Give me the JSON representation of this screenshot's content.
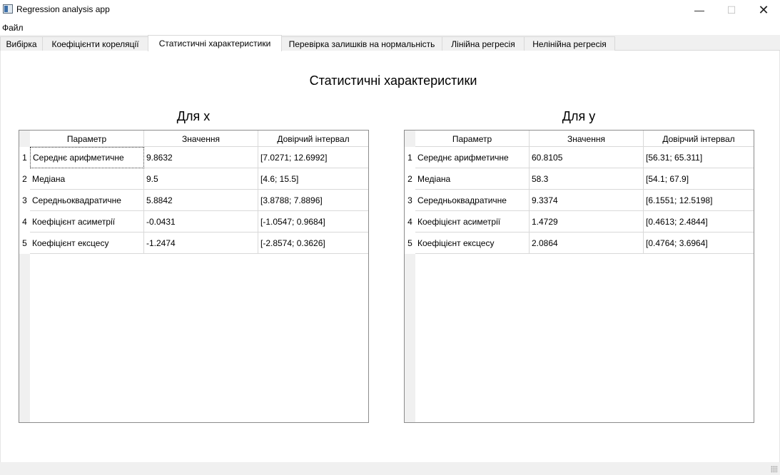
{
  "window": {
    "title": "Regression analysis app",
    "minimize_icon": "—",
    "maximize_icon": "☐",
    "close_icon": "✕"
  },
  "menu": {
    "file_label": "Файл"
  },
  "tabs": [
    {
      "label": "Вибірка"
    },
    {
      "label": "Коефіцієнти кореляції"
    },
    {
      "label": "Статистичні характеристики"
    },
    {
      "label": "Перевірка залишків на нормальність"
    },
    {
      "label": "Лінійна регресія"
    },
    {
      "label": "Нелінійна регресія"
    }
  ],
  "active_tab": 2,
  "page_title": "Статистичні характеристики",
  "columns": [
    "Параметр",
    "Значення",
    "Довірчий інтервал"
  ],
  "table_x": {
    "title": "Для x",
    "rows": [
      {
        "n": "1",
        "param": "Середнє арифметичне",
        "value": "9.8632",
        "ci": "[7.0271; 12.6992]"
      },
      {
        "n": "2",
        "param": "Медіана",
        "value": "9.5",
        "ci": "[4.6; 15.5]"
      },
      {
        "n": "3",
        "param": "Середньоквадратичне",
        "value": "5.8842",
        "ci": "[3.8788; 7.8896]"
      },
      {
        "n": "4",
        "param": "Коефіцієнт асиметрії",
        "value": "-0.0431",
        "ci": "[-1.0547; 0.9684]"
      },
      {
        "n": "5",
        "param": "Коефіцієнт ексцесу",
        "value": "-1.2474",
        "ci": "[-2.8574; 0.3626]"
      }
    ]
  },
  "table_y": {
    "title": "Для y",
    "rows": [
      {
        "n": "1",
        "param": "Середнє арифметичне",
        "value": "60.8105",
        "ci": "[56.31; 65.311]"
      },
      {
        "n": "2",
        "param": "Медіана",
        "value": "58.3",
        "ci": "[54.1; 67.9]"
      },
      {
        "n": "3",
        "param": "Середньоквадратичне",
        "value": "9.3374",
        "ci": "[6.1551; 12.5198]"
      },
      {
        "n": "4",
        "param": "Коефіцієнт асиметрії",
        "value": "1.4729",
        "ci": "[0.4613; 2.4844]"
      },
      {
        "n": "5",
        "param": "Коефіцієнт ексцесу",
        "value": "2.0864",
        "ci": "[0.4764; 3.6964]"
      }
    ]
  }
}
